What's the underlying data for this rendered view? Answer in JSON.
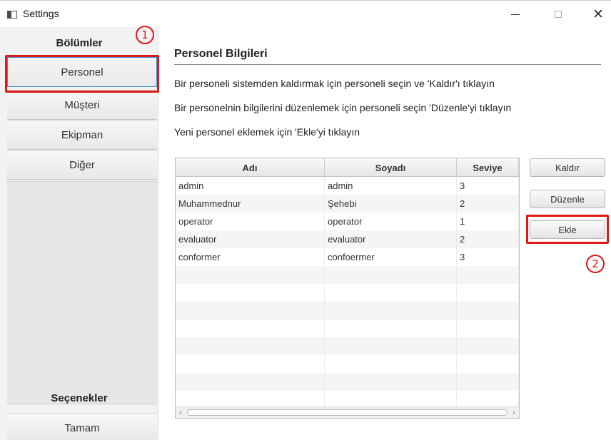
{
  "window": {
    "title": "Settings",
    "controls": {
      "minimize": "minimize-icon",
      "maximize": "maximize-icon",
      "close": "close-icon"
    }
  },
  "sidebar": {
    "header": "Bölümler",
    "items": [
      {
        "label": "Personel",
        "selected": true
      },
      {
        "label": "Müşteri",
        "selected": false
      },
      {
        "label": "Ekipman",
        "selected": false
      },
      {
        "label": "Diğer",
        "selected": false
      }
    ],
    "options_header": "Seçenekler",
    "ok_button": "Tamam"
  },
  "main": {
    "title": "Personel Bilgileri",
    "instructions": [
      "Bir personeli sistemden kaldırmak için personeli seçin ve 'Kaldır'ı tıklayın",
      "Bir personelnin bilgilerini düzenlemek için personeli seçin 'Düzenle'yi tıklayın",
      "Yeni personel eklemek için 'Ekle'yi tıklayın"
    ],
    "table": {
      "columns": [
        "Adı",
        "Soyadı",
        "Seviye"
      ],
      "rows": [
        [
          "admin",
          "admin",
          "3"
        ],
        [
          "Muhammednur",
          "Şehebi",
          "2"
        ],
        [
          "operator",
          "operator",
          "1"
        ],
        [
          "evaluator",
          "evaluator",
          "2"
        ],
        [
          "conformer",
          "confoermer",
          "3"
        ]
      ],
      "empty_rows": 8
    },
    "buttons": {
      "remove": "Kaldır",
      "edit": "Düzenle",
      "add": "Ekle"
    }
  },
  "annotations": {
    "marker1": "1",
    "marker2": "2",
    "color": "#e01818"
  },
  "colors": {
    "selection_border": "#3d8fd0",
    "annotation": "#e01818"
  }
}
